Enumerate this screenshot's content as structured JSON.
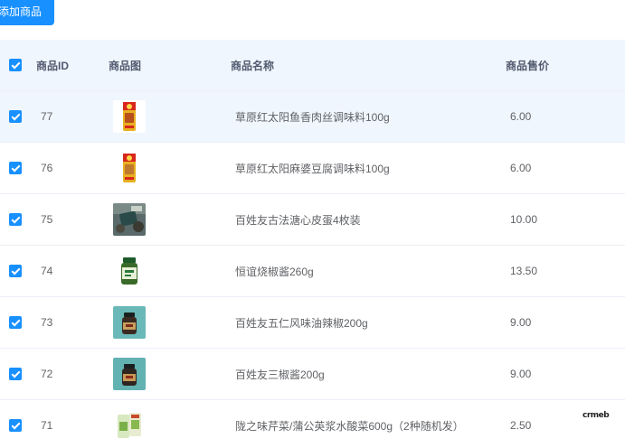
{
  "toolbar": {
    "add_label": "添加商品"
  },
  "table": {
    "columns": {
      "id": "商品ID",
      "image": "商品图",
      "name": "商品名称",
      "price": "商品售价"
    },
    "rows": [
      {
        "id": "77",
        "name": "草原红太阳鱼香肉丝调味料100g",
        "price": "6.00",
        "image_icon": "seasoning-pack-red-icon"
      },
      {
        "id": "76",
        "name": "草原红太阳麻婆豆腐调味料100g",
        "price": "6.00",
        "image_icon": "seasoning-pack-red-icon"
      },
      {
        "id": "75",
        "name": "百姓友古法溏心皮蛋4枚装",
        "price": "10.00",
        "image_icon": "preserved-egg-box-icon"
      },
      {
        "id": "74",
        "name": "恒谊烧椒酱260g",
        "price": "13.50",
        "image_icon": "sauce-jar-green-icon"
      },
      {
        "id": "73",
        "name": "百姓友五仁风味油辣椒200g",
        "price": "9.00",
        "image_icon": "chili-oil-jar-icon"
      },
      {
        "id": "72",
        "name": "百姓友三椒酱200g",
        "price": "9.00",
        "image_icon": "chili-sauce-jar-icon"
      },
      {
        "id": "71",
        "name": "陇之味芹菜/蒲公英浆水酸菜600g（2种随机发）",
        "price": "2.50",
        "image_icon": "pickled-vegetable-bag-icon"
      }
    ]
  },
  "watermark": {
    "text": "crmeb"
  },
  "colors": {
    "primary": "#1890ff",
    "header_bg": "#f0f6fe",
    "border": "#ebeef5"
  }
}
